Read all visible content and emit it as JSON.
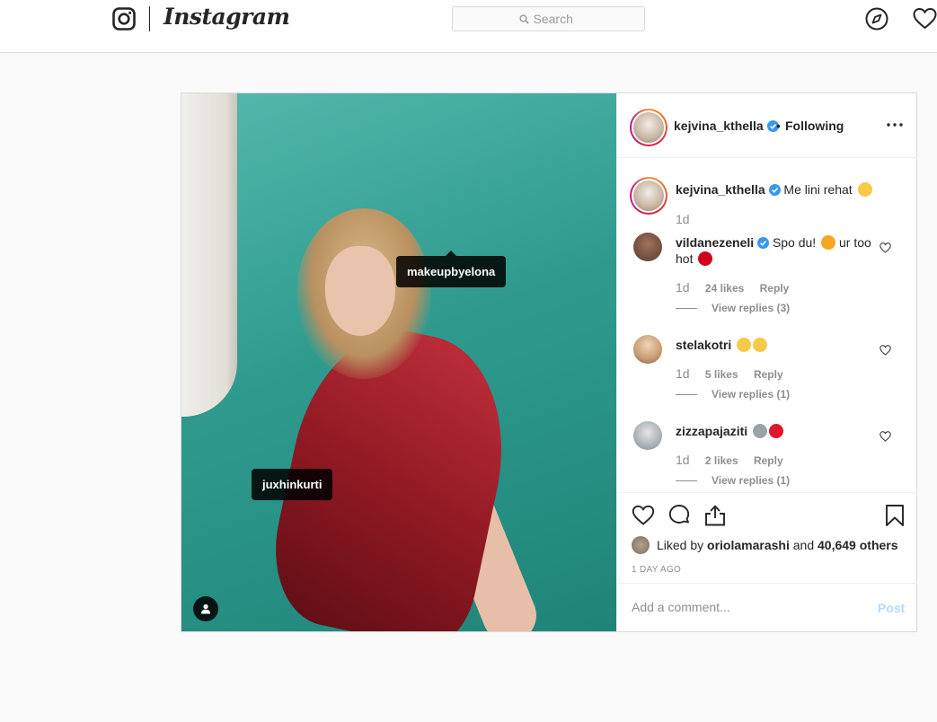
{
  "topbar": {
    "wordmark": "Instagram",
    "search_placeholder": "Search"
  },
  "post": {
    "photo_tags": [
      "makeupbyelona",
      "juxhinkurti"
    ],
    "header": {
      "username": "kejvina_kthella",
      "separator": "•",
      "follow_status": "Following"
    },
    "caption": {
      "username": "kejvina_kthella",
      "text": "Me lini rehat",
      "time": "1d"
    },
    "comments": [
      {
        "username": "vildanezeneli",
        "text": "Spo du!",
        "text_tail": "ur too hot",
        "time": "1d",
        "likes": "24 likes",
        "reply": "Reply",
        "view_replies": "View replies (3)"
      },
      {
        "username": "stelakotri",
        "text": "",
        "time": "1d",
        "likes": "5 likes",
        "reply": "Reply",
        "view_replies": "View replies (1)"
      },
      {
        "username": "zizzapajaziti",
        "text": "",
        "time": "1d",
        "likes": "2 likes",
        "reply": "Reply",
        "view_replies": "View replies (1)"
      }
    ],
    "likes": {
      "prefix": "Liked by",
      "user": "oriolamarashi",
      "conj": "and",
      "others": "40,649 others"
    },
    "time_ago": "1 DAY AGO",
    "comment_placeholder": "Add a comment...",
    "post_button": "Post"
  },
  "colors": {
    "verified": "#3897f0",
    "post_button": "#b3dbff",
    "border": "#dbdbdb"
  }
}
